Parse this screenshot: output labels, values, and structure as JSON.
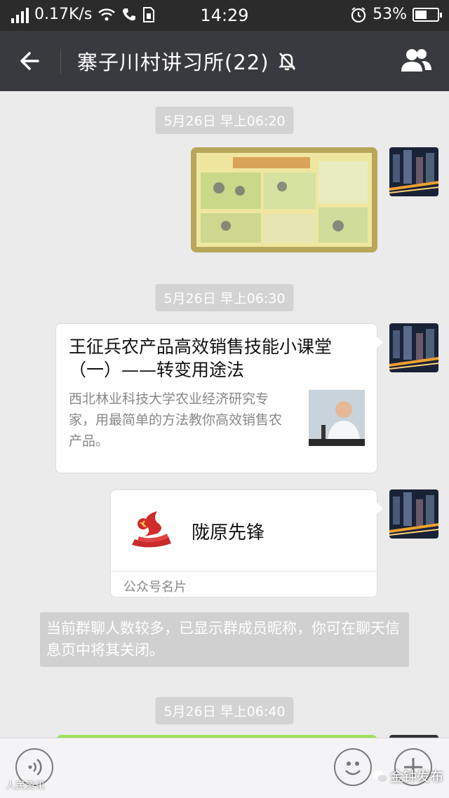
{
  "status_bar": {
    "speed": "0.17K/s",
    "time": "14:29",
    "battery_percent": "53%",
    "battery_level": 0.53
  },
  "header": {
    "title": "寨子川村讲习所(22)"
  },
  "messages": {
    "timestamps": [
      "5月26日 早上06:20",
      "5月26日 早上06:30",
      "5月26日 早上06:40"
    ],
    "article": {
      "title": "王征兵农产品高效销售技能小课堂（一）——转变用途法",
      "description": "西北林业科技大学农业经济研究专家，用最简单的方法教你高效销售农产品。"
    },
    "contact_card": {
      "name": "陇原先锋",
      "label": "公众号名片"
    },
    "system_notice": "当前群聊人数较多，已显示群成员昵称，你可在聊天信息页中将其关闭。"
  },
  "watermarks": {
    "left": "人民资讯",
    "right": "金钟发布"
  },
  "colors": {
    "header_bg": "#393a3f",
    "chat_bg": "#ebebeb",
    "timestamp_bg": "#d3d3d3",
    "sent_bubble_green": "#9ee05b"
  },
  "icons": [
    "back-arrow-icon",
    "mute-bell-icon",
    "group-members-icon",
    "voice-icon",
    "emoji-icon",
    "plus-icon"
  ]
}
